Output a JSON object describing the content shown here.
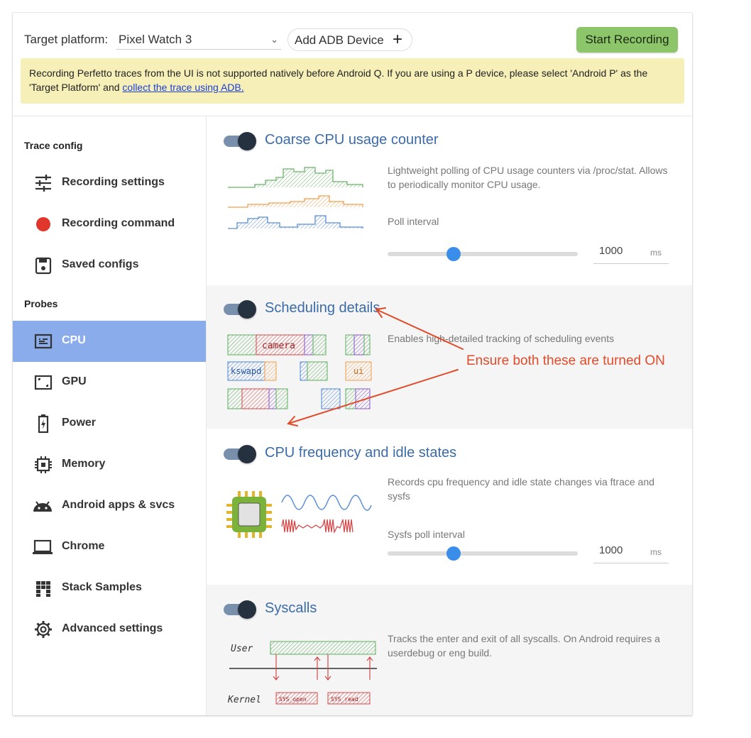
{
  "header": {
    "platform_label": "Target platform:",
    "platform_value": "Pixel Watch 3",
    "add_adb_label": "Add ADB Device",
    "start_recording_label": "Start Recording",
    "warning_text": "Recording Perfetto traces from the UI is not supported natively before Android Q. If you are using a P device, please select 'Android P' as the 'Target Platform' and ",
    "warning_link": "collect the trace using ADB."
  },
  "sidebar": {
    "trace_config_title": "Trace config",
    "probes_title": "Probes",
    "trace_items": [
      {
        "label": "Recording settings",
        "icon": "tune-icon"
      },
      {
        "label": "Recording command",
        "icon": "record-dot-icon"
      },
      {
        "label": "Saved configs",
        "icon": "save-icon"
      }
    ],
    "probe_items": [
      {
        "label": "CPU",
        "icon": "cpu-icon",
        "active": true
      },
      {
        "label": "GPU",
        "icon": "gpu-icon"
      },
      {
        "label": "Power",
        "icon": "battery-icon"
      },
      {
        "label": "Memory",
        "icon": "memory-chip-icon"
      },
      {
        "label": "Android apps & svcs",
        "icon": "android-icon"
      },
      {
        "label": "Chrome",
        "icon": "laptop-icon"
      },
      {
        "label": "Stack Samples",
        "icon": "stack-samples-icon"
      },
      {
        "label": "Advanced settings",
        "icon": "gear-icon"
      }
    ]
  },
  "probes": [
    {
      "title": "Coarse CPU usage counter",
      "enabled": true,
      "desc": "Lightweight polling of CPU usage counters via /proc/stat. Allows to periodically monitor CPU usage.",
      "slider_label": "Poll interval",
      "value": "1000",
      "unit": "ms"
    },
    {
      "title": "Scheduling details",
      "enabled": true,
      "desc": "Enables high-detailed tracking of scheduling events",
      "labels": [
        "camera",
        "kswapd",
        "ui"
      ]
    },
    {
      "title": "CPU frequency and idle states",
      "enabled": true,
      "desc": "Records cpu frequency and idle state changes via ftrace and sysfs",
      "slider_label": "Sysfs poll interval",
      "value": "1000",
      "unit": "ms"
    },
    {
      "title": "Syscalls",
      "enabled": true,
      "desc": "Tracks the enter and exit of all syscalls. On Android requires a userdebug or eng build.",
      "labels": [
        "User",
        "Kernel",
        "SYS_open",
        "SYS_read"
      ]
    }
  ],
  "annotation": {
    "text": "Ensure both these are turned ON",
    "color": "#e14b2a"
  },
  "colors": {
    "active_nav": "#8aaceb",
    "start_button": "#8dc56b",
    "warning_bg": "#f7efb8",
    "probe_title": "#3b6ba8",
    "slider_thumb": "#3a8de8"
  }
}
